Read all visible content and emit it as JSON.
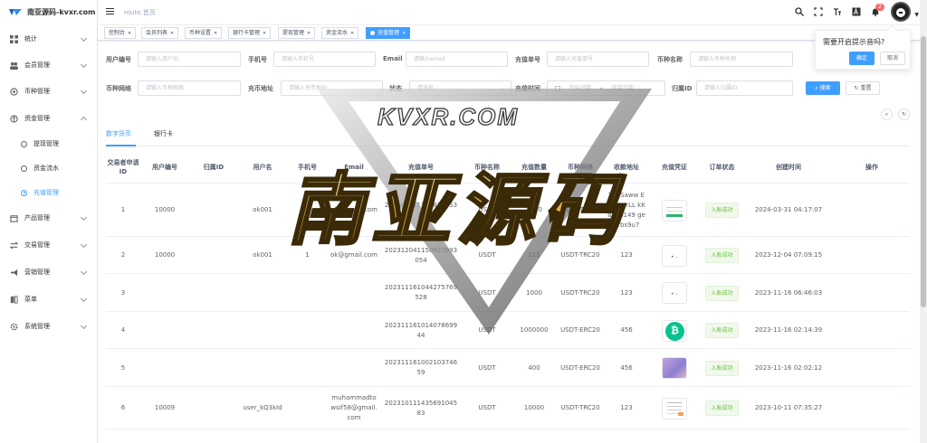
{
  "sidebar": {
    "logo_text": "南亚源码-kvxr.com",
    "menu": [
      {
        "label": "统计"
      },
      {
        "label": "会员管理"
      },
      {
        "label": "币种管理"
      },
      {
        "label": "资金管理"
      },
      {
        "label": "产品管理"
      },
      {
        "label": "交易管理"
      },
      {
        "label": "营销管理"
      },
      {
        "label": "菜单"
      },
      {
        "label": "系统管理"
      }
    ],
    "submenu": [
      {
        "label": "提现管理"
      },
      {
        "label": "资金流水"
      },
      {
        "label": "充值管理"
      }
    ]
  },
  "header": {
    "breadcrumb": "route.首页",
    "notification_count": "2"
  },
  "tags": [
    {
      "label": "控制台"
    },
    {
      "label": "会员列表"
    },
    {
      "label": "币种设置"
    },
    {
      "label": "银行卡管理"
    },
    {
      "label": "提现管理"
    },
    {
      "label": "资金流水"
    },
    {
      "label": "充值管理"
    }
  ],
  "form": {
    "user_no": {
      "label": "用户编号",
      "placeholder": "请输入用户ID"
    },
    "phone": {
      "label": "手机号",
      "placeholder": "请输入手机号"
    },
    "email": {
      "label": "Email",
      "placeholder": "请输入email"
    },
    "order_no": {
      "label": "充值单号",
      "placeholder": "请输入充值单号"
    },
    "coin_name": {
      "label": "币种名称",
      "placeholder": "请输入币种名称"
    },
    "coin_network": {
      "label": "币种网络",
      "placeholder": "请输入币种网络"
    },
    "coin_address": {
      "label": "充币地址",
      "placeholder": "请输入充币地址"
    },
    "status": {
      "label": "状态",
      "placeholder": "请选择"
    },
    "time": {
      "label": "充值时间",
      "start_placeholder": "开始日期",
      "separator": "–",
      "end_placeholder": "结束日期"
    },
    "owner_id": {
      "label": "归属ID",
      "placeholder": "请输入归属ID"
    },
    "search_button": "搜索",
    "reset_button": "重置"
  },
  "tabs": [
    {
      "label": "数字货币"
    },
    {
      "label": "银行卡"
    }
  ],
  "table": {
    "columns": [
      "交易者申请ID",
      "用户编号",
      "归属ID",
      "用户名",
      "手机号",
      "Email",
      "充值单号",
      "币种名称",
      "充值数量",
      "币种网络",
      "收款地址",
      "充值凭证",
      "订单状态",
      "创建时间",
      "操作"
    ],
    "rows": [
      {
        "id": "1",
        "user_no": "10000",
        "owner": "",
        "username": "ok001",
        "phone": "",
        "email": "ok@gmail.com",
        "order": "20240331117983165330",
        "coin": "USDT",
        "amount": "1000",
        "network": "USDT-TRC20",
        "address": "TEESaww EXwAXrLL kK8F6p149 geKrbs9u7",
        "voucher": "receipt",
        "status": "入账成功",
        "time": "2024-03-31 04:17:07"
      },
      {
        "id": "2",
        "user_no": "10000",
        "owner": "",
        "username": "ok001",
        "phone": "1",
        "email": "ok@gmail.com",
        "order": "202312041150927693054",
        "coin": "USDT",
        "amount": "111",
        "network": "USDT-TRC20",
        "address": "123",
        "voucher": "mini",
        "status": "入账成功",
        "time": "2023-12-04 07:09:15"
      },
      {
        "id": "3",
        "user_no": "",
        "owner": "",
        "username": "",
        "phone": "",
        "email": "",
        "order": "202311161044275769528",
        "coin": "USDT",
        "amount": "1000",
        "network": "USDT-TRC20",
        "address": "123",
        "voucher": "mini",
        "status": "入账成功",
        "time": "2023-11-16 06:46:03"
      },
      {
        "id": "4",
        "user_no": "",
        "owner": "",
        "username": "",
        "phone": "",
        "email": "",
        "order": "20231116101407869944",
        "coin": "USDT",
        "amount": "1000000",
        "network": "USDT-ERC20",
        "address": "456",
        "voucher": "coin",
        "status": "入账成功",
        "time": "2023-11-16 02:14:39"
      },
      {
        "id": "5",
        "user_no": "",
        "owner": "",
        "username": "",
        "phone": "",
        "email": "",
        "order": "20231116100210374659",
        "coin": "USDT",
        "amount": "400",
        "network": "USDT-ERC20",
        "address": "456",
        "voucher": "gradient",
        "status": "入账成功",
        "time": "2023-11-16 02:02:12"
      },
      {
        "id": "6",
        "user_no": "10009",
        "owner": "",
        "username": "user_kQ3kId",
        "phone": "",
        "email": "muhammadtowsif58@gmail.com",
        "order": "20231011143569104583",
        "coin": "USDT",
        "amount": "10000",
        "network": "USDT-TRC20",
        "address": "123",
        "voucher": "doc",
        "status": "入账成功",
        "time": "2023-10-11 07:35:27"
      }
    ]
  },
  "popover": {
    "text": "需要开启提示音吗?",
    "confirm": "确定",
    "cancel": "取消"
  },
  "watermark": {
    "small": "KVXR.COM",
    "big": "南亚源码"
  },
  "colors": {
    "primary": "#409eff",
    "success": "#67c23a"
  }
}
